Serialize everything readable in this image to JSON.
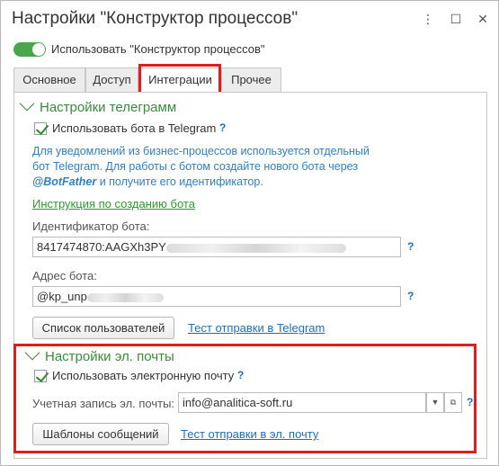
{
  "window": {
    "title": "Настройки \"Конструктор процессов\"",
    "menu_icon": "more-vertical-icon",
    "maximize_icon": "maximize-icon",
    "close_icon": "close-icon"
  },
  "use_toggle": {
    "label": "Использовать \"Конструктор процессов\"",
    "on": true,
    "color": "#4aa64a"
  },
  "tabs": [
    {
      "label": "Основное",
      "active": false
    },
    {
      "label": "Доступ",
      "active": false
    },
    {
      "label": "Интеграции",
      "active": true
    },
    {
      "label": "Прочее",
      "active": false
    }
  ],
  "telegram": {
    "header": "Настройки телеграмм",
    "use_bot_label": "Использовать бота в Telegram",
    "use_bot_checked": true,
    "help": "?",
    "info_line1": "Для уведомлений из бизнес-процессов используется отдельный",
    "info_line2": "бот Telegram. Для работы с ботом создайте нового бота через",
    "info_bold": "@BotFather",
    "info_line3_rest": " и получите его идентификатор.",
    "instruction_link": "Инструкция по созданию бота",
    "bot_id_caption": "Идентификатор бота:",
    "bot_id_value": "8417474870:AAGXh3PY",
    "bot_address_caption": "Адрес бота:",
    "bot_address_value": "@kp_unp",
    "users_button": "Список пользователей",
    "test_link": "Тест отправки в Telegram"
  },
  "email": {
    "header": "Настройки эл. почты",
    "use_email_label": "Использовать электронную почту",
    "use_email_checked": true,
    "help": "?",
    "account_caption": "Учетная запись эл. почты:",
    "account_value": "info@analitica-soft.ru",
    "templates_button": "Шаблоны сообщений",
    "test_link": "Тест отправки в эл. почту"
  },
  "colors": {
    "highlight": "#e01e1e",
    "green": "#3a8c3a",
    "blue_text": "#2f7fc1"
  }
}
